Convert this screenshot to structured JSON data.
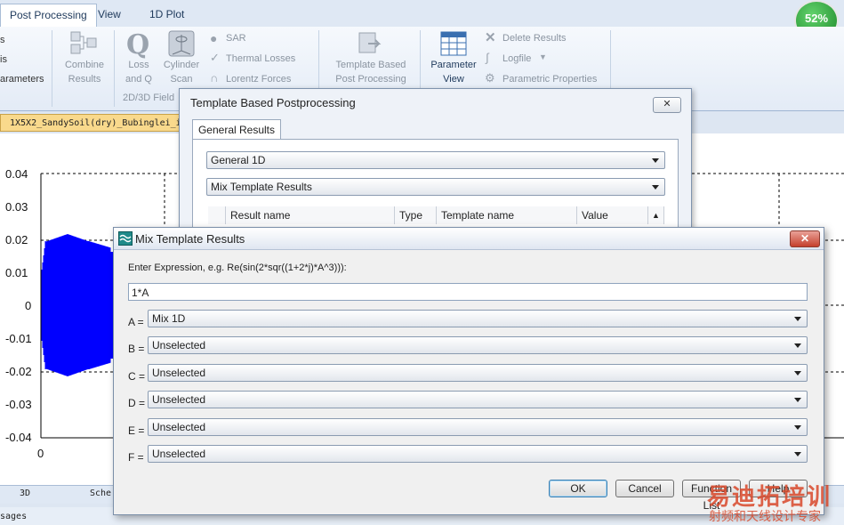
{
  "ribbon": {
    "tabs": [
      "Post Processing",
      "View",
      "1D Plot"
    ],
    "partial_items": [
      "s",
      "is",
      "arameters"
    ],
    "buttons": {
      "combine": [
        "Combine",
        "Results"
      ],
      "loss": [
        "Loss",
        "and Q"
      ],
      "cylinder": [
        "Cylinder",
        "Scan"
      ],
      "template": [
        "Template Based",
        "Post Processing"
      ],
      "parameter_view": [
        "Parameter",
        "View"
      ]
    },
    "small_items": [
      "SAR",
      "Thermal Losses",
      "Lorentz Forces"
    ],
    "right_items": [
      "Delete Results",
      "Logfile",
      "Parametric Properties"
    ],
    "group_caption": "2D/3D Field",
    "badge": "52%"
  },
  "doc_tab": "1X5X2_SandySoil(dry)_Bubinglei_i",
  "plot": {
    "y_ticks": [
      "0.04",
      "0.03",
      "0.02",
      "0.01",
      "0",
      "-0.01",
      "-0.02",
      "-0.03",
      "-0.04"
    ],
    "x_tick": "0"
  },
  "bottom_tabs": [
    "3D",
    "Sche"
  ],
  "status": "sages",
  "dialog1": {
    "title": "Template Based Postprocessing",
    "close": "✕",
    "tab": "General Results",
    "combo1": "General 1D",
    "combo2": "Mix Template Results",
    "columns": [
      "Result name",
      "Type",
      "Template name",
      "Value"
    ]
  },
  "dialog2": {
    "title": "Mix Template Results",
    "close": "✕",
    "hint": "Enter Expression, e.g. Re(sin(2*sqr((1+2*j)*A^3))):",
    "expression": "1*A",
    "rows": [
      {
        "letter": "A =",
        "value": "Mix 1D"
      },
      {
        "letter": "B =",
        "value": "Unselected"
      },
      {
        "letter": "C =",
        "value": "Unselected"
      },
      {
        "letter": "D =",
        "value": "Unselected"
      },
      {
        "letter": "E =",
        "value": "Unselected"
      },
      {
        "letter": "F =",
        "value": "Unselected"
      }
    ],
    "buttons": {
      "ok": "OK",
      "cancel": "Cancel",
      "function_list": "Function List",
      "help": "Help"
    }
  },
  "watermark": {
    "line1": "易迪拓培训",
    "line2": "射频和天线设计专家"
  },
  "colors": {
    "signal": "#0000ff",
    "accent": "#3c7fb1"
  }
}
